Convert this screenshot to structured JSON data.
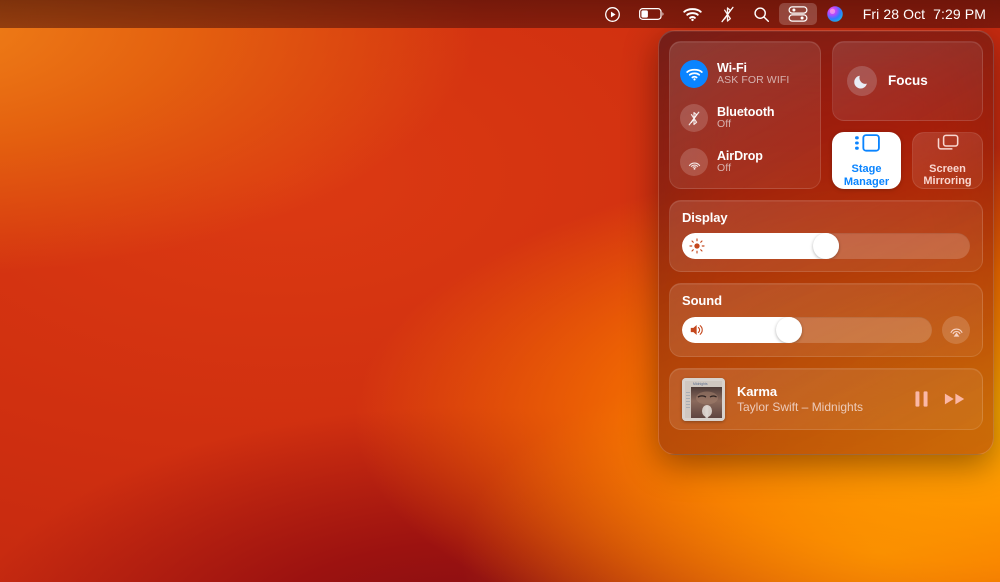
{
  "menubar": {
    "items": [
      {
        "name": "now-playing-icon",
        "label": "Now Playing"
      },
      {
        "name": "battery-icon",
        "label": "Battery",
        "level_percent": 35
      },
      {
        "name": "wifi-icon",
        "label": "Wi-Fi"
      },
      {
        "name": "bluetooth-off-icon",
        "label": "Bluetooth Off"
      },
      {
        "name": "search-icon",
        "label": "Spotlight Search"
      },
      {
        "name": "control-center-icon",
        "label": "Control Center"
      },
      {
        "name": "siri-icon",
        "label": "Siri"
      }
    ],
    "clock": "Fri 28 Oct  7:29 PM"
  },
  "control_center": {
    "connectivity": [
      {
        "title": "Wi-Fi",
        "subtitle": "ASK FOR WIFI",
        "state": "on",
        "icon": "wifi-icon"
      },
      {
        "title": "Bluetooth",
        "subtitle": "Off",
        "state": "off",
        "icon": "bluetooth-off-icon"
      },
      {
        "title": "AirDrop",
        "subtitle": "Off",
        "state": "off",
        "icon": "airdrop-icon"
      }
    ],
    "focus": {
      "label": "Focus",
      "icon": "moon-icon",
      "active": false
    },
    "tiles": [
      {
        "label": "Stage Manager",
        "line1": "Stage",
        "line2": "Manager",
        "icon": "stage-manager-icon",
        "active": true
      },
      {
        "label": "Screen Mirroring",
        "line1": "Screen",
        "line2": "Mirroring",
        "icon": "screen-mirroring-icon",
        "active": false
      }
    ],
    "display": {
      "title": "Display",
      "value_percent": 50,
      "icon": "brightness-icon"
    },
    "sound": {
      "title": "Sound",
      "value_percent": 42,
      "icon": "volume-icon",
      "output_icon": "airplay-icon"
    },
    "now_playing": {
      "title": "Karma",
      "subtitle": "Taylor Swift – Midnights",
      "album_art_alt": "Midnights album cover",
      "pause_icon": "pause-icon",
      "forward_icon": "fast-forward-icon"
    }
  },
  "colors": {
    "accent_blue": "#0a84ff",
    "panel_tint": "#5c2417",
    "wallpaper_orange": "#ff9000",
    "wallpaper_red": "#cf2f10"
  }
}
